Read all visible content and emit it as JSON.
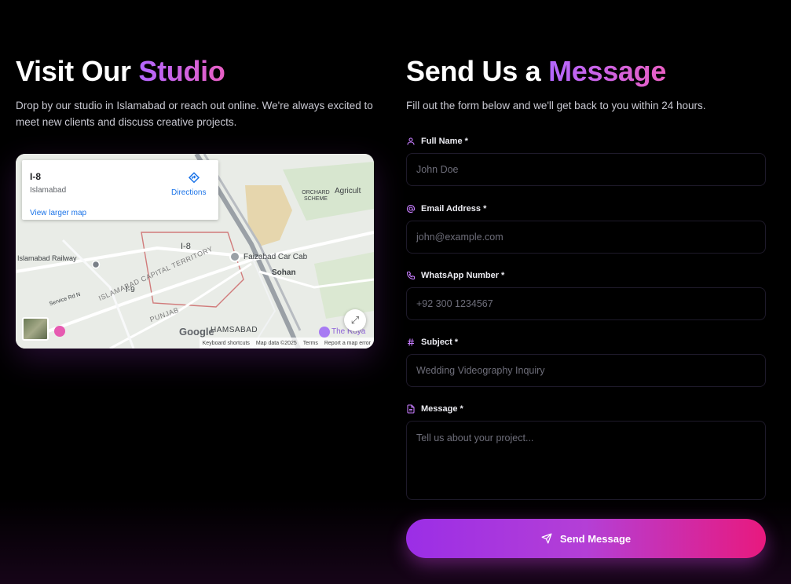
{
  "visit": {
    "title_plain": "Visit Our ",
    "title_accent": "Studio",
    "description": "Drop by our studio in Islamabad or reach out online. We're always excited to meet new clients and discuss creative projects."
  },
  "map": {
    "place_name": "I-8",
    "place_city": "Islamabad",
    "directions_label": "Directions",
    "view_larger": "View larger map",
    "labels": {
      "orchard": "ORCHARD SCHEME",
      "agricult": "Agricult",
      "i8": "I-8",
      "railway": "Islamabad Railway",
      "faizabad": "Faizabad Car Cab",
      "sohan": "Sohan",
      "i9": "I-9",
      "service_rd": "Service Rd N",
      "capital": "ISLAMABAD CAPITAL TERRITORY",
      "punjab": "PUNJAB",
      "hamsabad": "HAMSABAD",
      "royal": "The Roya"
    },
    "google_logo": "Google",
    "footer": {
      "shortcuts": "Keyboard shortcuts",
      "map_data": "Map data ©2025",
      "terms": "Terms",
      "report": "Report a map error"
    }
  },
  "contact": {
    "title_plain": "Send Us a ",
    "title_accent": "Message",
    "description": "Fill out the form below and we'll get back to you within 24 hours.",
    "fields": {
      "name": {
        "label": "Full Name *",
        "placeholder": "John Doe"
      },
      "email": {
        "label": "Email Address *",
        "placeholder": "john@example.com"
      },
      "whatsapp": {
        "label": "WhatsApp Number *",
        "placeholder": "+92 300 1234567"
      },
      "subject": {
        "label": "Subject *",
        "placeholder": "Wedding Videography Inquiry"
      },
      "message": {
        "label": "Message *",
        "placeholder": "Tell us about your project..."
      }
    },
    "submit_label": "Send Message"
  },
  "icons": {
    "name": "user-icon",
    "email": "at-sign-icon",
    "whatsapp": "phone-icon",
    "subject": "hash-icon",
    "message": "file-text-icon",
    "submit": "send-icon"
  },
  "colors": {
    "accent_purple": "#b366ff",
    "accent_pink": "#e85fc3",
    "button_start": "#9b2ee6",
    "button_end": "#e8197e",
    "background": "#000000"
  }
}
